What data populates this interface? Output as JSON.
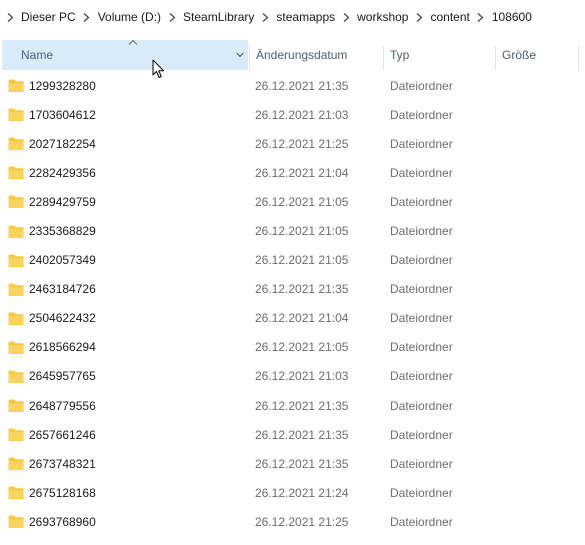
{
  "breadcrumb": [
    "Dieser PC",
    "Volume (D:)",
    "SteamLibrary",
    "steamapps",
    "workshop",
    "content",
    "108600"
  ],
  "columns": {
    "name": "Name",
    "date": "Änderungsdatum",
    "type": "Typ",
    "size": "Größe"
  },
  "rows": [
    {
      "name": "1299328280",
      "date": "26.12.2021 21:35",
      "type": "Dateiordner"
    },
    {
      "name": "1703604612",
      "date": "26.12.2021 21:03",
      "type": "Dateiordner"
    },
    {
      "name": "2027182254",
      "date": "26.12.2021 21:25",
      "type": "Dateiordner"
    },
    {
      "name": "2282429356",
      "date": "26.12.2021 21:04",
      "type": "Dateiordner"
    },
    {
      "name": "2289429759",
      "date": "26.12.2021 21:05",
      "type": "Dateiordner"
    },
    {
      "name": "2335368829",
      "date": "26.12.2021 21:05",
      "type": "Dateiordner"
    },
    {
      "name": "2402057349",
      "date": "26.12.2021 21:05",
      "type": "Dateiordner"
    },
    {
      "name": "2463184726",
      "date": "26.12.2021 21:35",
      "type": "Dateiordner"
    },
    {
      "name": "2504622432",
      "date": "26.12.2021 21:04",
      "type": "Dateiordner"
    },
    {
      "name": "2618566294",
      "date": "26.12.2021 21:05",
      "type": "Dateiordner"
    },
    {
      "name": "2645957765",
      "date": "26.12.2021 21:03",
      "type": "Dateiordner"
    },
    {
      "name": "2648779556",
      "date": "26.12.2021 21:35",
      "type": "Dateiordner"
    },
    {
      "name": "2657661246",
      "date": "26.12.2021 21:35",
      "type": "Dateiordner"
    },
    {
      "name": "2673748321",
      "date": "26.12.2021 21:35",
      "type": "Dateiordner"
    },
    {
      "name": "2675128168",
      "date": "26.12.2021 21:24",
      "type": "Dateiordner"
    },
    {
      "name": "2693768960",
      "date": "26.12.2021 21:25",
      "type": "Dateiordner"
    }
  ],
  "colors": {
    "header_active_bg": "#d9ebf9",
    "header_text": "#4c607a",
    "folder_yellow": "#f8c843",
    "secondary_text": "#6d6d6d"
  },
  "icons": {
    "folder": "folder-icon",
    "separator": "chevron-right-icon",
    "sort": "sort-ascending-icon",
    "dropdown": "chevron-down-icon",
    "cursor": "mouse-pointer-icon"
  }
}
